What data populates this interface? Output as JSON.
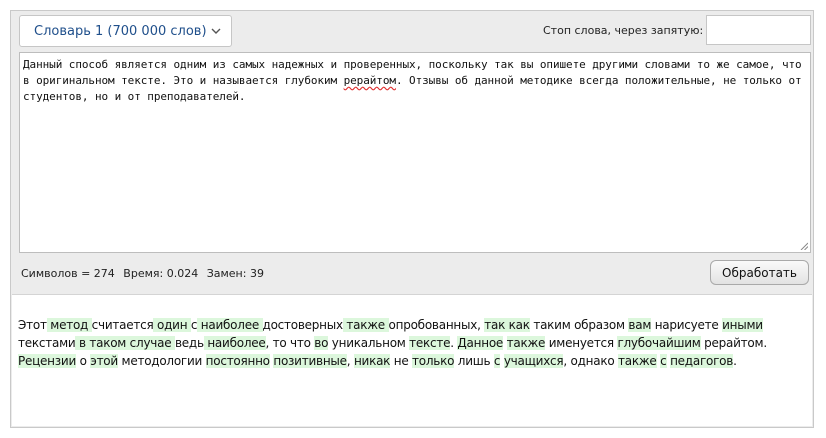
{
  "toolbar": {
    "dictionary_label": "Словарь 1 (700 000 слов)",
    "stopwords_label": "Стоп слова, через запятую:",
    "stopwords_value": "",
    "stopwords_placeholder": ""
  },
  "source": {
    "before_misspelled": "Данный способ является одним из самых надежных и проверенных, поскольку так вы опишете другими словами то же самое, что в оригинальном тексте. Это и называется глубоким ",
    "misspelled": "рерайтом",
    "after_misspelled": ". Отзывы об данной методике всегда положительные, не только от студентов, но и от преподавателей."
  },
  "stats": {
    "symbols": "Символов = 274",
    "time": "Время: 0.024",
    "replacements": "Замен: 39"
  },
  "process_button_label": "Обработать",
  "result": {
    "segments": [
      {
        "t": "Этот",
        "h": false
      },
      {
        "t": " метод ",
        "h": true
      },
      {
        "t": "считается",
        "h": false
      },
      {
        "t": " один ",
        "h": true
      },
      {
        "t": "с",
        "h": false
      },
      {
        "t": " наиболее ",
        "h": true
      },
      {
        "t": "достоверных",
        "h": false
      },
      {
        "t": " также ",
        "h": true
      },
      {
        "t": "опробованных",
        "h": false
      },
      {
        "t": ", ",
        "h": false
      },
      {
        "t": "так как",
        "h": true
      },
      {
        "t": " таким образом ",
        "h": false
      },
      {
        "t": "вам",
        "h": true
      },
      {
        "t": " нарисуете ",
        "h": false
      },
      {
        "t": "иными",
        "h": true
      },
      {
        "t": " ",
        "h": false
      },
      {
        "t": "текстами",
        "h": false
      },
      {
        "t": " в таком случае ",
        "h": true
      },
      {
        "t": "ведь",
        "h": false
      },
      {
        "t": " наиболее",
        "h": true
      },
      {
        "t": ", то что ",
        "h": false
      },
      {
        "t": "во",
        "h": true
      },
      {
        "t": " уникальном ",
        "h": false
      },
      {
        "t": "тексте",
        "h": true
      },
      {
        "t": ". ",
        "h": false
      },
      {
        "t": "Данное",
        "h": true
      },
      {
        "t": " ",
        "h": false
      },
      {
        "t": "также",
        "h": true
      },
      {
        "t": " именуется ",
        "h": false
      },
      {
        "t": "глубочайшим",
        "h": true
      },
      {
        "t": " рерайтом. ",
        "h": false
      },
      {
        "t": "Рецензии",
        "h": true
      },
      {
        "t": " о ",
        "h": false
      },
      {
        "t": "этой",
        "h": true
      },
      {
        "t": " методологии ",
        "h": false
      },
      {
        "t": "постоянно",
        "h": true
      },
      {
        "t": " ",
        "h": false
      },
      {
        "t": "позитивные",
        "h": true
      },
      {
        "t": ", ",
        "h": false
      },
      {
        "t": "никак",
        "h": true
      },
      {
        "t": " не ",
        "h": false
      },
      {
        "t": "только",
        "h": true
      },
      {
        "t": " лишь ",
        "h": false
      },
      {
        "t": "с",
        "h": true
      },
      {
        "t": " ",
        "h": false
      },
      {
        "t": "учащихся",
        "h": true
      },
      {
        "t": ", однако ",
        "h": false
      },
      {
        "t": "также",
        "h": true
      },
      {
        "t": " ",
        "h": false
      },
      {
        "t": "с",
        "h": true
      },
      {
        "t": " ",
        "h": false
      },
      {
        "t": "педагогов",
        "h": true
      },
      {
        "t": ".",
        "h": false
      }
    ]
  },
  "colors": {
    "highlight": "#dcf7dc",
    "link_text": "#1f4f8b",
    "panel_bg": "#ececec"
  }
}
